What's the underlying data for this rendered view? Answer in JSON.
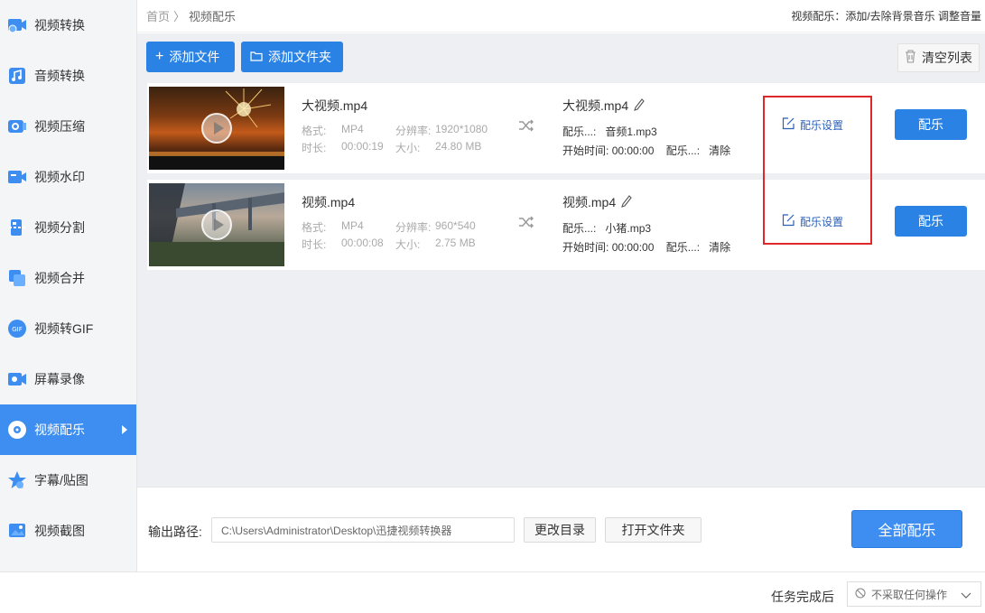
{
  "sidebar": {
    "items": [
      {
        "label": "视频转换",
        "icon": "video-convert-icon"
      },
      {
        "label": "音频转换",
        "icon": "audio-convert-icon"
      },
      {
        "label": "视频压缩",
        "icon": "video-compress-icon"
      },
      {
        "label": "视频水印",
        "icon": "video-watermark-icon"
      },
      {
        "label": "视频分割",
        "icon": "video-split-icon"
      },
      {
        "label": "视频合并",
        "icon": "video-merge-icon"
      },
      {
        "label": "视频转GIF",
        "icon": "gif-icon"
      },
      {
        "label": "屏幕录像",
        "icon": "screen-record-icon"
      },
      {
        "label": "视频配乐",
        "icon": "video-music-icon",
        "active": true
      },
      {
        "label": "字幕/贴图",
        "icon": "subtitle-sticker-icon"
      },
      {
        "label": "视频截图",
        "icon": "video-screenshot-icon"
      }
    ]
  },
  "header": {
    "breadcrumb_home": "首页",
    "breadcrumb_sep": "〉",
    "breadcrumb_current": "视频配乐",
    "hint": "视频配乐：添加/去除背景音乐 调整音量"
  },
  "toolbar": {
    "add_file": "添加文件",
    "add_folder": "添加文件夹",
    "clear_list": "清空列表"
  },
  "files": [
    {
      "name": "大视频.mp4",
      "format_label": "格式:",
      "format": "MP4",
      "resolution_label": "分辨率:",
      "resolution": "1920*1080",
      "duration_label": "时长:",
      "duration": "00:00:19",
      "size_label": "大小:",
      "size": "24.80 MB",
      "output_name": "大视频.mp4",
      "music_label": "配乐...:",
      "music": "音频1.mp3",
      "start_label": "开始时间:",
      "start": "00:00:00",
      "music2_label": "配乐...:",
      "clear": "清除",
      "settings": "配乐设置",
      "action": "配乐"
    },
    {
      "name": "视频.mp4",
      "format_label": "格式:",
      "format": "MP4",
      "resolution_label": "分辨率:",
      "resolution": "960*540",
      "duration_label": "时长:",
      "duration": "00:00:08",
      "size_label": "大小:",
      "size": "2.75 MB",
      "output_name": "视频.mp4",
      "music_label": "配乐...:",
      "music": "小猪.mp3",
      "start_label": "开始时间:",
      "start": "00:00:00",
      "music2_label": "配乐...:",
      "clear": "清除",
      "settings": "配乐设置",
      "action": "配乐"
    }
  ],
  "output": {
    "label": "输出路径:",
    "path": "C:\\Users\\Administrator\\Desktop\\迅捷视频转换器",
    "change_dir": "更改目录",
    "open_folder": "打开文件夹",
    "apply_all": "全部配乐"
  },
  "footer": {
    "after_label": "任务完成后",
    "after_value": "不采取任何操作"
  },
  "colors": {
    "accent": "#3d8ef0",
    "button": "#2a82e4",
    "highlight_box": "#e0282a"
  }
}
